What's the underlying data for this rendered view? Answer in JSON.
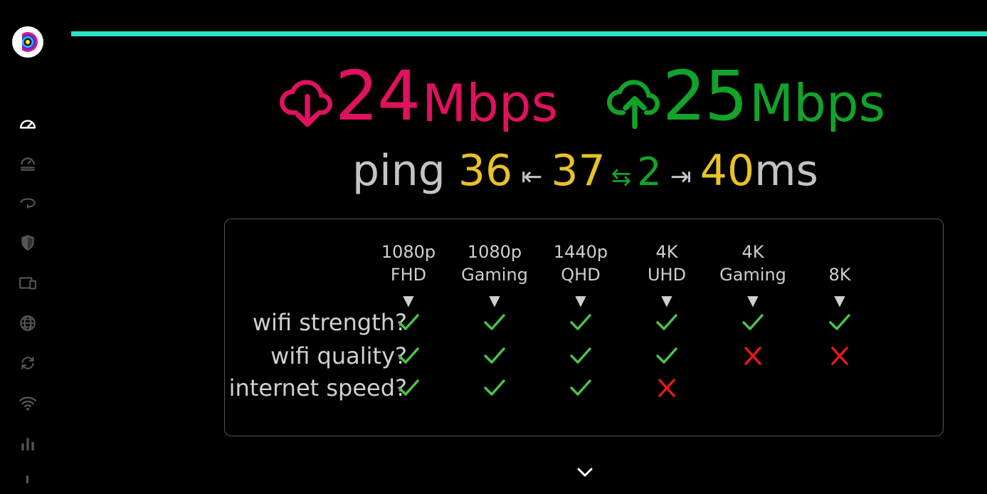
{
  "app": {
    "logo": "app-logo"
  },
  "sidebar": {
    "items": [
      {
        "icon": "speedometer-icon",
        "active": true
      },
      {
        "icon": "speed-history-icon",
        "active": false
      },
      {
        "icon": "vpn-icon",
        "active": false
      },
      {
        "icon": "shield-icon",
        "active": false
      },
      {
        "icon": "devices-icon",
        "active": false
      },
      {
        "icon": "globe-icon",
        "active": false
      },
      {
        "icon": "sync-icon",
        "active": false
      },
      {
        "icon": "wifi-icon",
        "active": false
      },
      {
        "icon": "bar-chart-icon",
        "active": false
      }
    ]
  },
  "progress": {
    "value": 1.0,
    "color": "#2ee0c8"
  },
  "download": {
    "value": "24",
    "unit": "Mbps",
    "color": "#e0115f"
  },
  "upload": {
    "value": "25",
    "unit": "Mbps",
    "color": "#12a32a"
  },
  "ping": {
    "label": "ping",
    "min": "36",
    "left_arrow": "⇤",
    "avg": "37",
    "jitter_icon": "⇆",
    "jitter": "2",
    "right_arrow": "⇥",
    "max": "40",
    "unit": "ms"
  },
  "quality_table": {
    "columns": [
      {
        "line1": "1080p",
        "line2": "FHD"
      },
      {
        "line1": "1080p",
        "line2": "Gaming"
      },
      {
        "line1": "1440p",
        "line2": "QHD"
      },
      {
        "line1": "4K",
        "line2": "UHD"
      },
      {
        "line1": "4K",
        "line2": "Gaming"
      },
      {
        "line1": "",
        "line2": "8K"
      }
    ],
    "arrow": "▼",
    "rows": [
      {
        "label": "wifi strength?",
        "values": [
          "yes",
          "yes",
          "yes",
          "yes",
          "yes",
          "yes"
        ]
      },
      {
        "label": "wifi quality?",
        "values": [
          "yes",
          "yes",
          "yes",
          "yes",
          "no",
          "no"
        ]
      },
      {
        "label": "internet speed?",
        "values": [
          "yes",
          "yes",
          "yes",
          "no",
          "",
          ""
        ]
      }
    ]
  },
  "colors": {
    "check": "#4cc24c",
    "cross": "#e81818"
  }
}
